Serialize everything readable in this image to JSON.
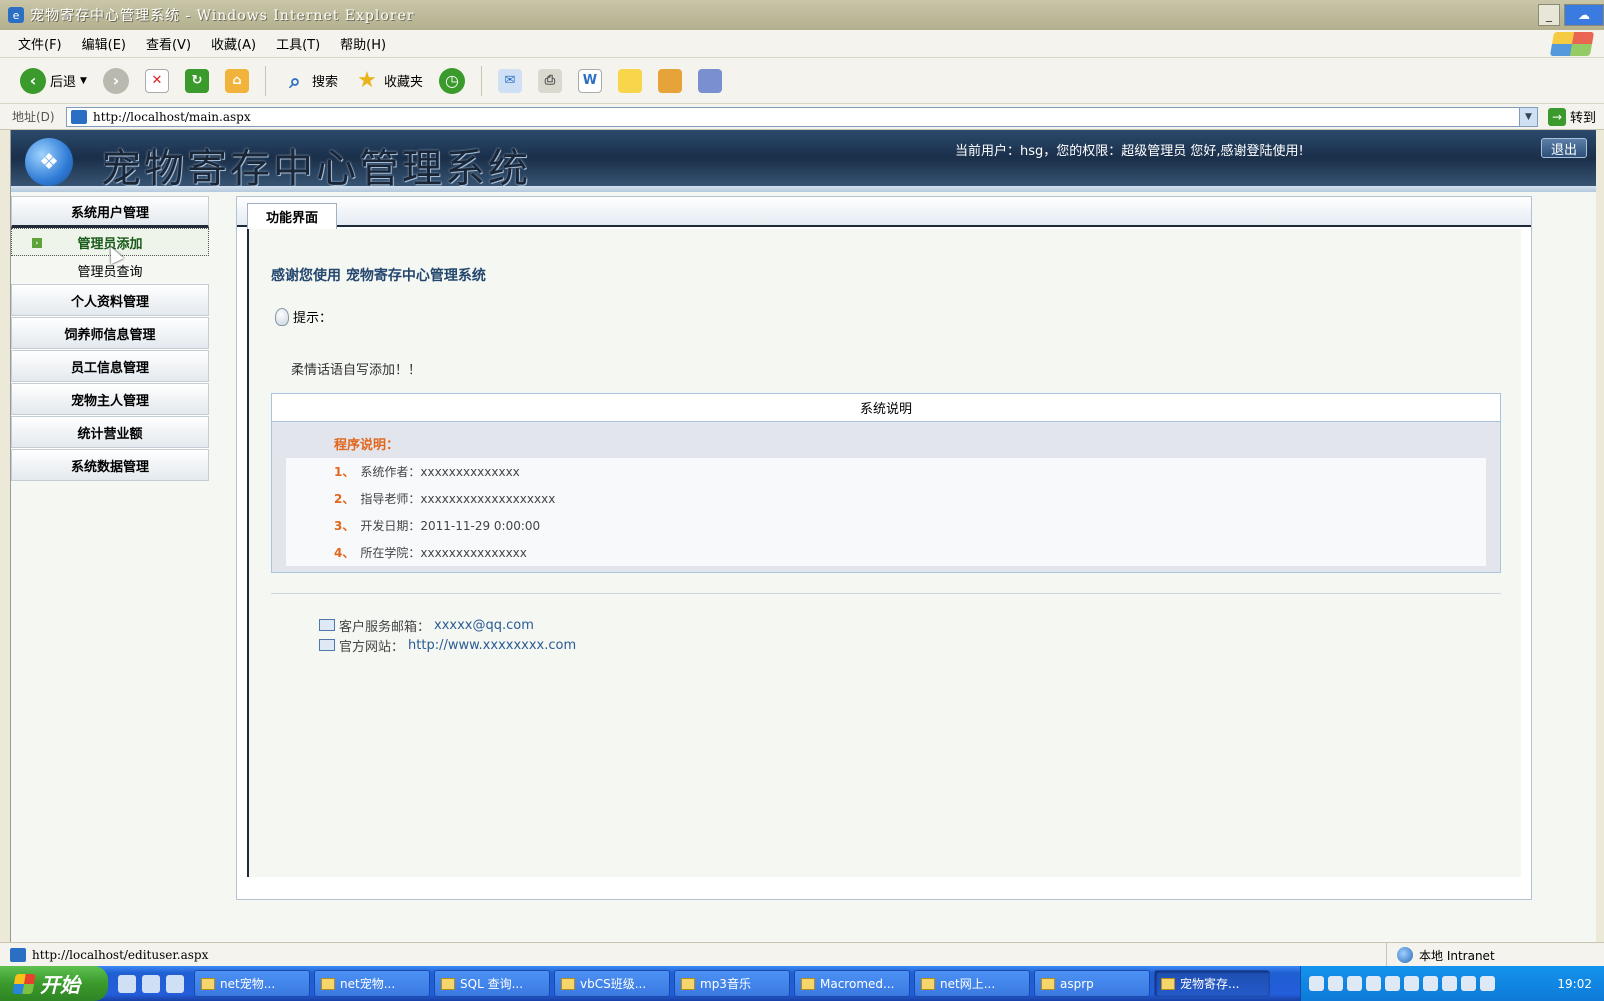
{
  "window": {
    "title": "宠物寄存中心管理系统 - Windows Internet Explorer"
  },
  "menu": [
    "文件(F)",
    "编辑(E)",
    "查看(V)",
    "收藏(A)",
    "工具(T)",
    "帮助(H)"
  ],
  "toolbar": {
    "back_label": "后退",
    "search_label": "搜索",
    "favorites_label": "收藏夹"
  },
  "address": {
    "label": "地址(D)",
    "url": "http://localhost/main.aspx",
    "go_label": "转到"
  },
  "banner": {
    "system_title": "宠物寄存中心管理系统",
    "user_info": "当前用户：hsg，您的权限：超级管理员  您好,感谢登陆使用!",
    "logout_label": "退出"
  },
  "sidebar": {
    "group_user": "系统用户管理",
    "item_admin_add": "管理员添加",
    "item_admin_query": "管理员查询",
    "group_profile": "个人资料管理",
    "group_trainer": "饲养师信息管理",
    "group_staff": "员工信息管理",
    "group_owner": "宠物主人管理",
    "group_revenue": "统计营业额",
    "group_data": "系统数据管理"
  },
  "main": {
    "tab_label": "功能界面",
    "welcome": "感谢您使用  宠物寄存中心管理系统",
    "hint_label": "提示：",
    "tip_text": "柔情话语自写添加！！",
    "sysbox_header": "系统说明",
    "program_title": "程序说明：",
    "rows": [
      {
        "n": "1、",
        "text": "系统作者：xxxxxxxxxxxxxx"
      },
      {
        "n": "2、",
        "text": "指导老师：xxxxxxxxxxxxxxxxxxx"
      },
      {
        "n": "3、",
        "text": "  开发日期：2011-11-29 0:00:00"
      },
      {
        "n": "4、",
        "text": "所在学院：xxxxxxxxxxxxxxx"
      }
    ],
    "email_label": "客户服务邮箱：",
    "email_value": "xxxxx@qq.com",
    "site_label": "官方网站：",
    "site_value": "http://www.xxxxxxxx.com"
  },
  "status": {
    "url": "http://localhost/edituser.aspx",
    "zone": "本地 Intranet"
  },
  "taskbar": {
    "start_label": "开始",
    "tasks": [
      "net宠物...",
      "net宠物...",
      "SQL 查询...",
      "vbCS班级...",
      "mp3音乐",
      "Macromed...",
      "net网上...",
      "asprp",
      "宠物寄存..."
    ],
    "clock": "19:02"
  }
}
